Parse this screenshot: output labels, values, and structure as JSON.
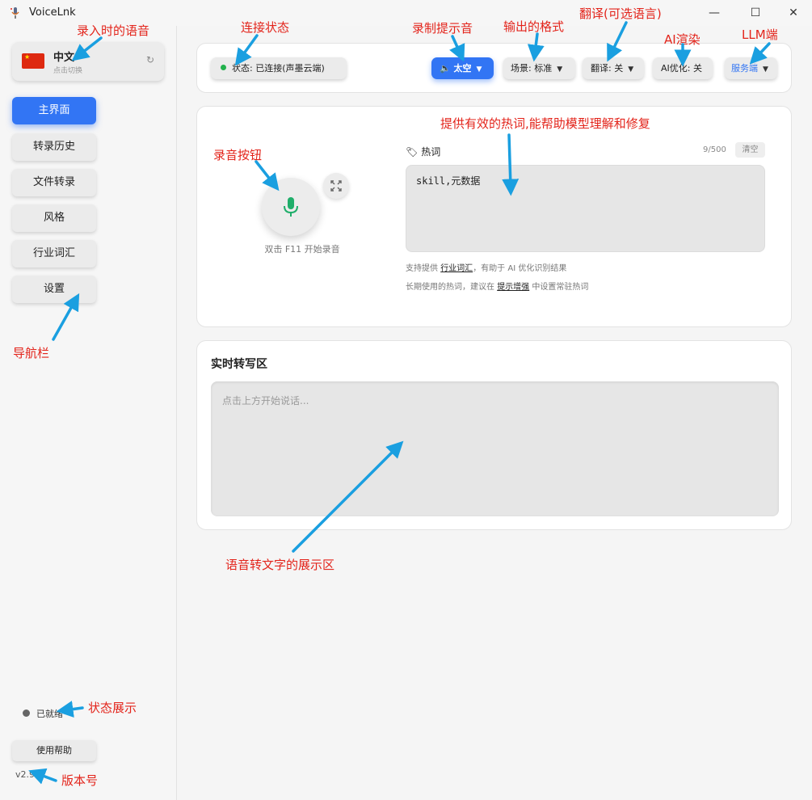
{
  "window": {
    "title": "VoiceLnk",
    "minimize": "—",
    "maximize": "☐",
    "close": "✕"
  },
  "sidebar": {
    "language": {
      "name": "中文",
      "hint": "点击切换",
      "refresh": "↻"
    },
    "nav": [
      {
        "label": "主界面",
        "active": true
      },
      {
        "label": "转录历史"
      },
      {
        "label": "文件转录"
      },
      {
        "label": "风格"
      },
      {
        "label": "行业词汇"
      },
      {
        "label": "设置"
      }
    ],
    "status": "已就绪",
    "help_button": "使用帮助",
    "version": "v2.9"
  },
  "topbar": {
    "connection": "状态: 已连接(声墨云端)",
    "sound_label": "太空",
    "scene_label": "场景: 标准",
    "translate_label": "翻译: 关",
    "ai_label": "AI优化: 关",
    "server_label": "服务端",
    "caret": "▼",
    "sound_icon": "🔈"
  },
  "record": {
    "hint": "双击 F11 开始录音"
  },
  "hotwords": {
    "title": "热词",
    "count": "9/500",
    "clear": "清空",
    "value": "skill,元数据",
    "note1_a": "支持提供 ",
    "note1_link": "行业词汇",
    "note1_b": "，有助于 AI 优化识别结果",
    "note2_a": "长期使用的热词，建议在 ",
    "note2_link": "提示增强",
    "note2_b": " 中设置常驻热词"
  },
  "transcript": {
    "title": "实时转写区",
    "placeholder": "点击上方开始说话..."
  },
  "annotations": {
    "input_language": "录入时的语音",
    "connection_status": "连接状态",
    "record_sound": "录制提示音",
    "output_format": "输出的格式",
    "translate": "翻译(可选语言)",
    "ai_render": "AI渲染",
    "llm_end": "LLM端",
    "hotword_tip": "提供有效的热词,能帮助模型理解和修复",
    "record_button": "录音按钮",
    "nav_bar": "导航栏",
    "display_area": "语音转文字的展示区",
    "status_display": "状态展示",
    "version": "版本号"
  },
  "colors": {
    "accent": "#3275f4",
    "annotation": "#e3241b",
    "arrow": "#1a9fe0",
    "connected": "#22b14c"
  }
}
